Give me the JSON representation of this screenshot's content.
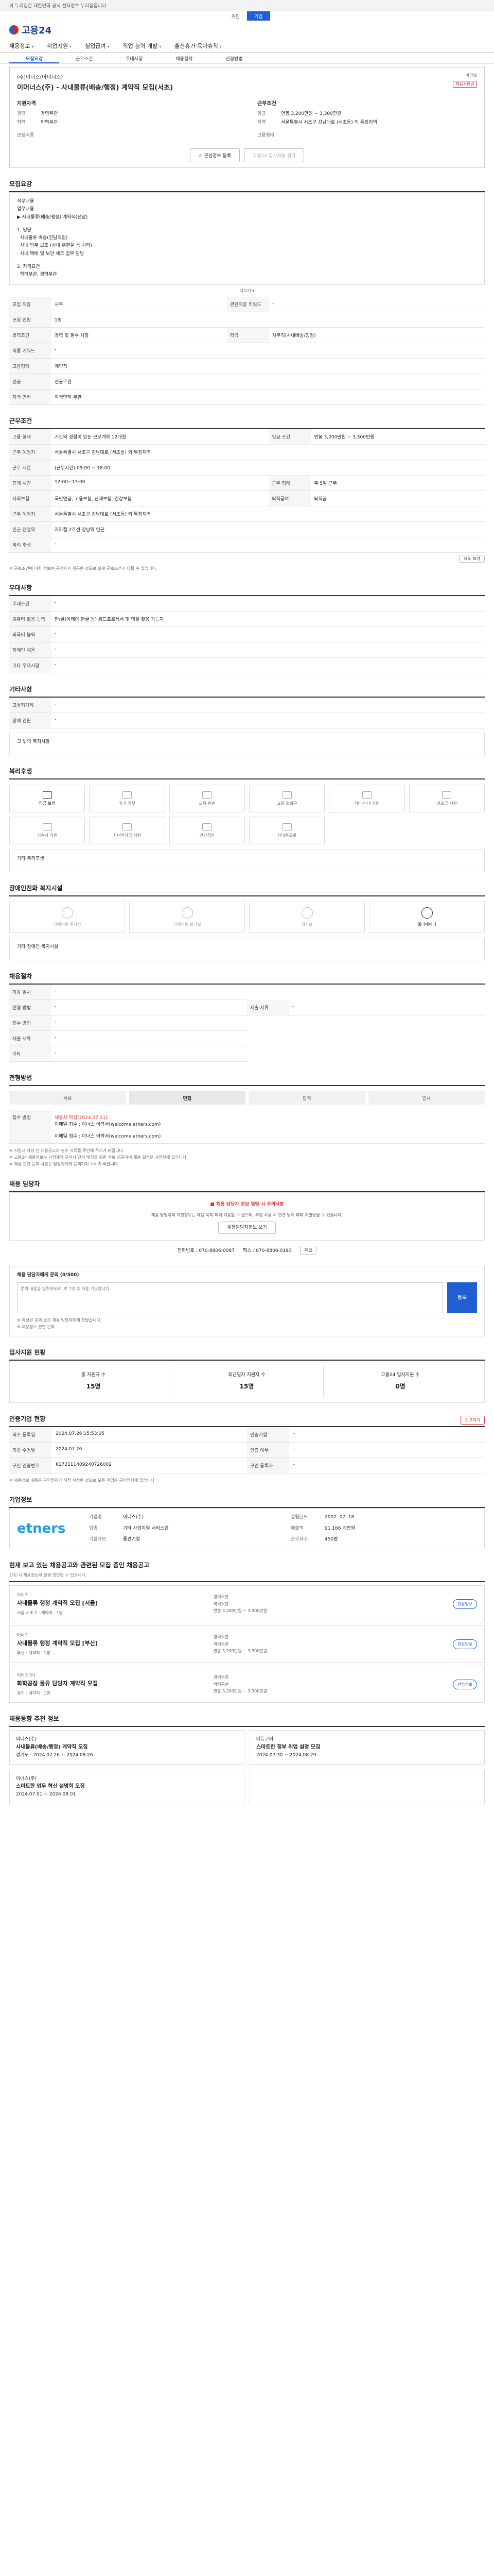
{
  "topbar": {
    "notice": "이 누리집은 대한민국 공식 전자정부 누리집입니다."
  },
  "util": {
    "items": [
      "개인",
      "기업"
    ]
  },
  "brand": {
    "name": "고용24"
  },
  "gnb": {
    "items": [
      "채용정보",
      "취업지원",
      "실업급여",
      "직업 능력 개발",
      "출산휴가·육아휴직"
    ]
  },
  "tabs": {
    "items": [
      "모집요강",
      "근무조건",
      "우대사항",
      "채용절차",
      "전형방법"
    ]
  },
  "summary": {
    "company": "(주)이너스(아이너스)",
    "title": "이머너스(주) - 사내물류(배송/행정) 계약직 모집(서초)",
    "dday_label": "마감일",
    "badge": "채용시마감",
    "left_head": "지원자격",
    "right_head": "근무조건",
    "left": [
      {
        "k": "경력",
        "v": "경력무관"
      },
      {
        "k": "학력",
        "v": "학력무관"
      },
      {
        "k": "",
        "v": ""
      },
      {
        "k": "모집직종",
        "v": ""
      }
    ],
    "right": [
      {
        "k": "임금",
        "v": "연봉 3,200만원 ~ 3,300만원"
      },
      {
        "k": "지역",
        "v": "서울특별시 서초구 강남대로 (서초동) 외 특정지역"
      },
      {
        "k": "",
        "v": ""
      },
      {
        "k": "고용형태",
        "v": ""
      }
    ],
    "btn_scrap": "관심정보 등록",
    "btn_apply": "고용24 입사지원 불가"
  },
  "recruit": {
    "title": "모집요강",
    "desc": [
      "직무내용",
      "업무내용",
      "▶ 사내물류(배송/행정) 계약직(전담)",
      "",
      "1. 담당",
      "  · 사내물류 배송(전담직원)",
      "  · 사내 업무 보조 (사내 우편물 등 처리)",
      "  · 사내 택배 및 보안 체크 업무 담당",
      "",
      "2. 자격요건",
      "  · 학력무관, 경력무관"
    ],
    "more": "더보기 ▾",
    "rows": [
      {
        "k": "모집 직종",
        "v": "사무",
        "k2": "관련직종 키워드",
        "v2": "-"
      },
      {
        "k": "모집 인원",
        "v": "1명",
        "k2": "",
        "v2": ""
      },
      {
        "k": "경력조건",
        "v": "경력 및 필수 사항",
        "k2": "학력",
        "v2": "사무직(사내배송/행정)"
      },
      {
        "k": "직종 키워드",
        "v": "-",
        "k2": "",
        "v2": ""
      },
      {
        "k": "고용형태",
        "v": "계약직",
        "k2": "",
        "v2": ""
      },
      {
        "k": "전공",
        "v": "전공무관",
        "k2": "",
        "v2": ""
      },
      {
        "k": "자격 면허",
        "v": "자격면허 무관",
        "k2": "",
        "v2": ""
      }
    ]
  },
  "work": {
    "title": "근무조건",
    "rows": [
      {
        "k": "고용 형태",
        "v": "기간의 정함이 있는 근로계약 12개월",
        "k2": "임금 조건",
        "v2": "연봉 3,200만원 ~ 3,300만원"
      },
      {
        "k": "근무 예정지",
        "v": "서울특별시 서초구 강남대로 (서초동) 외 특정지역",
        "k2": "",
        "v2": ""
      },
      {
        "k": "근무 시간",
        "v": "(근무시간) 09:00 ~ 18:00",
        "k2": "",
        "v2": ""
      },
      {
        "k": "휴게 시간",
        "v": "12:00~13:00",
        "k2": "근무 형태",
        "v2": "주 5일 근무"
      },
      {
        "k": "사회보험",
        "v": "국민연금, 고용보험, 산재보험, 건강보험",
        "k2": "퇴직급여",
        "v2": "퇴직금"
      },
      {
        "k": "근무 예정지",
        "v": "서울특별시 서초구 강남대로 (서초동) 외 특정지역",
        "k2": "",
        "v2": ""
      },
      {
        "k": "인근 전철역",
        "v": "지하철 2호선 강남역 인근",
        "k2": "",
        "v2": ""
      },
      {
        "k": "복리 후생",
        "v": "-",
        "k2": "",
        "v2": ""
      }
    ],
    "map_btn": "지도 보기",
    "note": "※ 근로조건에 대한 정보는 구인자가 제공한 것으로 실제 근로조건과 다를 수 있습니다."
  },
  "prefer": {
    "title": "우대사항",
    "rows": [
      {
        "k": "우대조건",
        "v": "-"
      },
      {
        "k": "컴퓨터 활용 능력",
        "v": "한/글(아래아 한글 등) 워드프로세서 및 엑셀 활용 가능자"
      },
      {
        "k": "외국어 능력",
        "v": "-"
      },
      {
        "k": "장애인 채용",
        "v": "-"
      },
      {
        "k": "기타 우대사항",
        "v": "-"
      }
    ]
  },
  "welfare": {
    "title": "기타사항",
    "rows": [
      {
        "k": "고용허가제",
        "v": "-"
      },
      {
        "k": "장애 인원",
        "v": "-"
      }
    ],
    "etc": "그 밖의 복지사항"
  },
  "benefits": {
    "title": "복리후생",
    "cards": [
      {
        "label": "연금·보험",
        "on": true
      },
      {
        "label": "휴가·휴무",
        "on": false
      },
      {
        "label": "교육·훈련",
        "on": false
      },
      {
        "label": "교통·출퇴근",
        "on": false
      },
      {
        "label": "식비·식대 지원",
        "on": false
      },
      {
        "label": "경조금 지원",
        "on": false
      },
      {
        "label": "기숙사 지원",
        "on": false
      },
      {
        "label": "자녀학자금 지원",
        "on": false
      },
      {
        "label": "건강검진",
        "on": false
      },
      {
        "label": "사내동호회",
        "on": false
      }
    ],
    "etc": "기타 복리후생"
  },
  "disabled": {
    "title": "장애인친화 복지시설",
    "cards": [
      {
        "label": "장애인용 주차장",
        "on": false
      },
      {
        "label": "장애인용 화장실",
        "on": false
      },
      {
        "label": "경사로",
        "on": false
      },
      {
        "label": "엘리베이터",
        "on": true
      }
    ],
    "etc": "기타 장애인 복지시설"
  },
  "process": {
    "title": "채용절차",
    "rows": [
      {
        "k": "마감 일시",
        "v": "-"
      },
      {
        "k": "전형 방법",
        "v": "-",
        "k2": "제출 서류",
        "v2": "-"
      },
      {
        "k": "접수 방법",
        "v": "-"
      },
      {
        "k": "제출 서류",
        "v": "-"
      },
      {
        "k": "기타",
        "v": "-"
      }
    ]
  },
  "method": {
    "title": "전형방법",
    "steps": [
      "서류",
      "면접",
      "합격",
      "입사"
    ],
    "desc_k": "채용시 마감(2024.07.31)",
    "desc_head": "접수 방법",
    "contact_line": "이메일 접수 : 이너스 이력서(welcome.etners.com)",
    "contact_line2": "이메일 접수 : 이너스 이력서(welcome.etners.com)",
    "notes": [
      "※ 지원서 작성 전 채용공고의 필수 서류를 확인해 주시기 바랍니다.",
      "※ 고용24 채용정보는 사업체와 구직자 간의 매칭을 위한 정보 제공이며 채용 결정은 사업체에 있습니다.",
      "※ 채용 관련 문의 사항은 담당자에게 문의하여 주시기 바랍니다."
    ]
  },
  "manager": {
    "title": "채용 담당자",
    "warn": "■ 채용 담당자 정보 열람 시 주의사항",
    "desc": "채용 담당자의 개인정보는 채용 목적 외에 이용할 수 없으며, 부정 사용 시 관련 법에 따라 처벌받을 수 있습니다.",
    "btn": "채용담당자정보 보기",
    "phone": "전화번호 : 070-8806-0087",
    "fax": "팩스 : 070-8806-0193",
    "email_btn": "메일"
  },
  "qna": {
    "title": "채용 담당자에게 문의 (0/500)",
    "placeholder": "문의 내용을 입력하세요. 로그인 후 이용 가능합니다.",
    "submit": "등록",
    "notes": [
      "※ 작성된 문의 글은 채용 담당자에게 전달됩니다.",
      "※ 채용정보 관련 문의"
    ]
  },
  "applicants": {
    "title": "입사지원 현황",
    "stats": [
      {
        "k": "총 지원자 수",
        "v": "15명"
      },
      {
        "k": "최근일자 지원자 수",
        "v": "15명"
      },
      {
        "k": "고용24 입사지원 수",
        "v": "0명"
      }
    ]
  },
  "status": {
    "title": "인증기업 현황",
    "report_btn": "신고하기",
    "rows": [
      {
        "k": "최초 등록일",
        "v": "2024.07.26 15:53:05"
      },
      {
        "k": "인증기업",
        "v": "-"
      },
      {
        "k": "최종 수정일",
        "v": "2024.07.26"
      },
      {
        "k": "인증 여부",
        "v": "-"
      },
      {
        "k": "구인 인증번호",
        "v": "K172111409240726002"
      },
      {
        "k": "구인 등록자",
        "v": "-"
      }
    ],
    "note": "※ 채용정보 내용은 구인업체가 직접 작성한 것으로 모든 책임은 구인업체에 있습니다."
  },
  "company": {
    "title": "기업정보",
    "logo": "etners",
    "rows": [
      {
        "k": "기업명",
        "v": "이너스(주)"
      },
      {
        "k": "설립년도",
        "v": "2002. 07. 18"
      },
      {
        "k": "업종",
        "v": "기타 사업지원 서비스업"
      },
      {
        "k": "매출액",
        "v": "91,166 백만원"
      },
      {
        "k": "기업규모",
        "v": "중견기업"
      },
      {
        "k": "근로자수",
        "v": "450명"
      }
    ]
  },
  "related": {
    "title": "현재 보고 있는 채용공고와 관련된 모집 중인 채용공고",
    "sub": "신청 시 채용정보와 함께 확인할 수 있습니다.",
    "items": [
      {
        "co": "이너스",
        "title": "사내물류 행정 계약직 모집 [서울]",
        "meta": "서울 서초구 · 계약직 · 1명",
        "r1": "경력무관",
        "r2": "학력무관",
        "r3": "연봉 3,200만원 ~ 3,300만원",
        "save": "관심정보"
      },
      {
        "co": "이너스",
        "title": "사내물류 행정 계약직 모집 [부산]",
        "meta": "부산 · 계약직 · 1명",
        "r1": "경력무관",
        "r2": "학력무관",
        "r3": "연봉 3,200만원 ~ 3,300만원",
        "save": "관심정보"
      },
      {
        "co": "이너스(주)",
        "title": "화학공장 물류 담당자 계약직 모집",
        "meta": "경기 · 계약직 · 1명",
        "r1": "경력무관",
        "r2": "학력무관",
        "r3": "연봉 3,200만원 ~ 3,300만원",
        "save": "관심정보"
      }
    ]
  },
  "recent": {
    "title": "채용동향 추천 정보",
    "items": [
      {
        "co": "이너스(주)",
        "title": "사내물류(배송/행정) 계약직 모집",
        "meta": "경기도 · 2024.07.26 ~ 2024.08.26"
      },
      {
        "co": "에듀코어",
        "title": "스마트한 정부 취업 설명 모집",
        "meta": "2024.07.30 ~ 2024.08.29"
      },
      {
        "co": "이너스(주)",
        "title": "스마트한 업무 혁신 설명회 모집",
        "meta": "2024.07.01 ~ 2024.08.01"
      },
      {
        "co": "",
        "title": "",
        "meta": ""
      }
    ]
  }
}
